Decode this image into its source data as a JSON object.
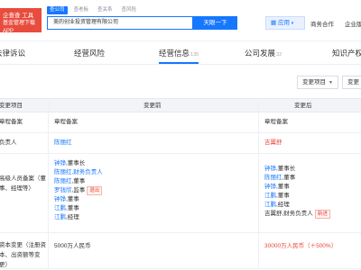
{
  "header": {
    "logo_line1": "企查查 工具",
    "logo_line2": "基金管理下载APP",
    "search_tabs": [
      "查公司",
      "查老板",
      "查关系",
      "查风险"
    ],
    "search_value": "美的创业投资管理有限公司",
    "search_button": "天眼一下",
    "apps_button": "应用",
    "nav_biz": "商务合作",
    "nav_ent": "企业版"
  },
  "category_tabs": [
    {
      "label": "法律诉讼",
      "count": ""
    },
    {
      "label": "经营风险",
      "count": ""
    },
    {
      "label": "经营信息",
      "count": "135"
    },
    {
      "label": "公司发展",
      "count": "32"
    },
    {
      "label": "知识产权",
      "count": ""
    }
  ],
  "filters": {
    "change_type": "变更项目",
    "change_filter": "变更"
  },
  "table": {
    "headers": [
      "变更项目",
      "变更前",
      "变更后"
    ],
    "rows": [
      {
        "item": [
          "章程备案"
        ],
        "before": [
          {
            "text": "章程备案",
            "style": "plain"
          }
        ],
        "after": [
          {
            "text": "章程备案",
            "style": "plain"
          }
        ]
      },
      {
        "item": [
          "负责人"
        ],
        "before": [
          {
            "text": "陈丽红",
            "style": "blue"
          }
        ],
        "after": [
          {
            "text": "吉翼舒",
            "style": "red"
          }
        ]
      },
      {
        "item": [
          "高级人员备案（董事、经理等）"
        ],
        "before": [
          {
            "name": "钟铮",
            "suffix": ",董事长"
          },
          {
            "name": "陈丽红",
            "suffix": ",财务负责人"
          },
          {
            "name": "陈丽红",
            "suffix": ",董事"
          },
          {
            "name": "罗钱欣",
            "suffix": ",监事",
            "tag": "退出"
          },
          {
            "name": "钟铮",
            "suffix": ",董事"
          },
          {
            "name": "江鹏",
            "suffix": ",董事"
          },
          {
            "name": "江鹏",
            "suffix": ",经理"
          }
        ],
        "after": [
          {
            "name": "钟铮",
            "suffix": ",董事长"
          },
          {
            "name": "陈丽红",
            "suffix": ",董事"
          },
          {
            "name": "钟铮",
            "suffix": ",董事"
          },
          {
            "name": "江鹏",
            "suffix": ",董事"
          },
          {
            "name": "江鹏",
            "suffix": ",经理"
          },
          {
            "name": "吉翼舒",
            "suffix": ",财务负责人",
            "tag": "新进"
          }
        ]
      },
      {
        "item": [
          "资本变更（注册资本、出资额等变更）"
        ],
        "before": [
          {
            "text": "5000万人民币",
            "style": "plain"
          }
        ],
        "after": [
          {
            "text": "30000万人民币",
            "style": "red"
          },
          {
            "text": "（＋500%）",
            "style": "red"
          }
        ]
      }
    ]
  }
}
